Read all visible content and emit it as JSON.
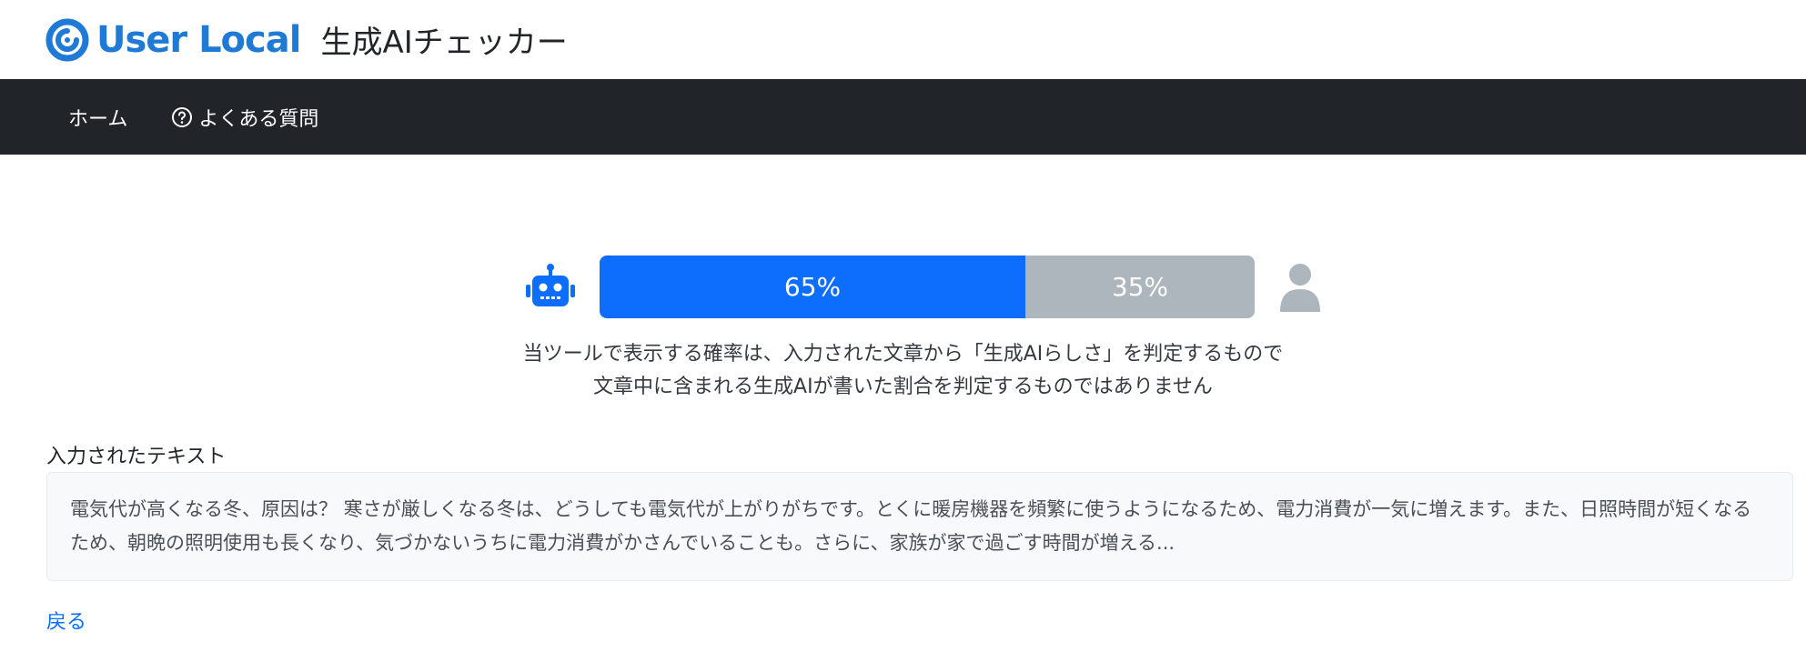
{
  "header": {
    "logo_text": "User Local",
    "app_title": "生成AIチェッカー",
    "brand_color": "#1f7ad6"
  },
  "nav": {
    "home_label": "ホーム",
    "faq_label": "よくある質問",
    "faq_icon": "question-circle-icon"
  },
  "result": {
    "ai_icon": "robot-icon",
    "human_icon": "person-icon",
    "ai_percent": 65,
    "ai_label": "65%",
    "human_percent": 35,
    "human_label": "35%",
    "ai_color": "#0d6efd",
    "human_color": "#adb5bd"
  },
  "notice": {
    "line1": "当ツールで表示する確率は、入力された文章から「生成AIらしさ」を判定するもので",
    "line2": "文章中に含まれる生成AIが書いた割合を判定するものではありません"
  },
  "input": {
    "label": "入力されたテキスト",
    "text": "電気代が高くなる冬、原因は？ 寒さが厳しくなる冬は、どうしても電気代が上がりがちです。とくに暖房機器を頻繁に使うようになるため、電力消費が一気に増えます。また、日照時間が短くなるため、朝晩の照明使用も長くなり、気づかないうちに電力消費がかさんでいることも。さらに、家族が家で過ごす時間が増える..."
  },
  "footer": {
    "back_label": "戻る"
  }
}
